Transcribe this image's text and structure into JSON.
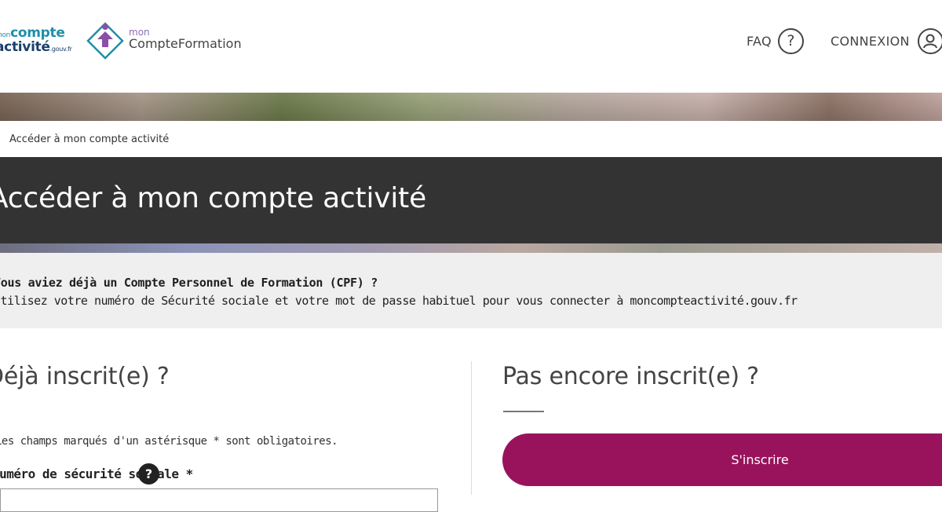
{
  "header": {
    "logo_moncompteactivite": {
      "mon": "mon",
      "compte": "compte",
      "activite": "activité",
      "gouv": ".gouv.fr"
    },
    "logo_compteformation": {
      "mon": "mon",
      "name": "CompteFormation"
    },
    "nav": {
      "faq": "FAQ",
      "faq_icon": "question-circle-icon",
      "login": "CONNEXION",
      "login_icon": "user-circle-icon"
    }
  },
  "breadcrumb": {
    "current": "Accéder à mon compte activité"
  },
  "page_title": "Accéder à mon compte activité",
  "info": {
    "question": "Vous aviez déjà un Compte Personnel de Formation (CPF) ?",
    "detail": "Utilisez votre numéro de Sécurité sociale et votre mot de passe habituel pour vous connecter à moncompteactivité.gouv.fr"
  },
  "login_section": {
    "title": "Déjà inscrit(e) ?",
    "required_note": "Les champs marqués d'un astérisque * sont obligatoires.",
    "ss_label": "Numéro de sécurité sociale *",
    "help_icon": "?"
  },
  "signup_section": {
    "title": "Pas encore inscrit(e) ?",
    "button_label": "S'inscrire"
  },
  "colors": {
    "title_banner": "#333333",
    "signup_button": "#99135c",
    "info_bg": "#efefef",
    "logo_teal": "#1f8fa8",
    "logo_navy": "#1b3f6b",
    "logo_purple": "#8a6bb8"
  }
}
